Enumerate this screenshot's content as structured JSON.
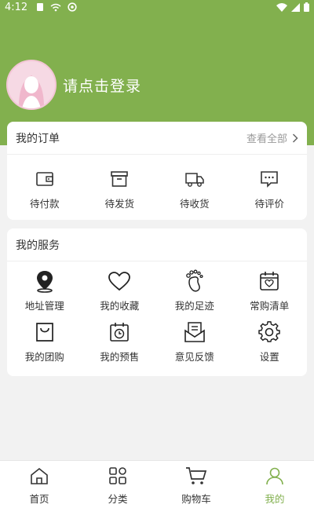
{
  "status_bar": {
    "time": "4:12"
  },
  "profile": {
    "login_prompt": "请点击登录"
  },
  "orders": {
    "title": "我的订单",
    "view_all": "查看全部",
    "items": [
      {
        "label": "待付款",
        "icon": "wallet-icon"
      },
      {
        "label": "待发货",
        "icon": "box-icon"
      },
      {
        "label": "待收货",
        "icon": "truck-icon"
      },
      {
        "label": "待评价",
        "icon": "comment-icon"
      }
    ]
  },
  "services": {
    "title": "我的服务",
    "items": [
      {
        "label": "地址管理",
        "icon": "location-pin-icon"
      },
      {
        "label": "我的收藏",
        "icon": "heart-icon"
      },
      {
        "label": "我的足迹",
        "icon": "footprint-icon"
      },
      {
        "label": "常购清单",
        "icon": "calendar-heart-icon"
      },
      {
        "label": "我的团购",
        "icon": "shopping-bag-icon"
      },
      {
        "label": "我的预售",
        "icon": "calendar-clock-icon"
      },
      {
        "label": "意见反馈",
        "icon": "feedback-envelope-icon"
      },
      {
        "label": "设置",
        "icon": "gear-icon"
      }
    ]
  },
  "tabbar": {
    "items": [
      {
        "label": "首页",
        "icon": "home-icon"
      },
      {
        "label": "分类",
        "icon": "category-grid-icon"
      },
      {
        "label": "购物车",
        "icon": "cart-icon"
      },
      {
        "label": "我的",
        "icon": "person-icon"
      }
    ],
    "active_index": 3
  },
  "colors": {
    "accent": "#82b04e",
    "background": "#f2f2f2",
    "card": "#ffffff"
  }
}
